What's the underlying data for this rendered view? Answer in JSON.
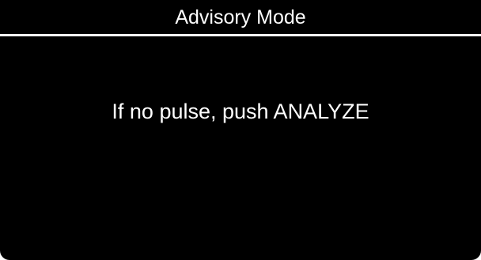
{
  "header": {
    "title": "Advisory Mode"
  },
  "main": {
    "message": "If no pulse, push ANALYZE"
  },
  "colors": {
    "background": "#000000",
    "foreground": "#ffffff"
  }
}
